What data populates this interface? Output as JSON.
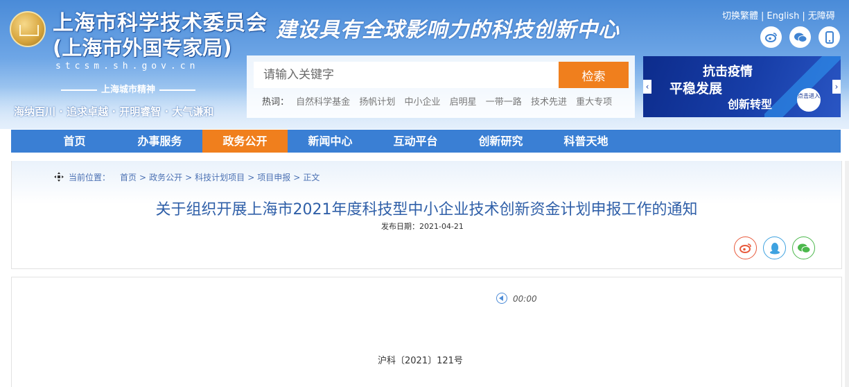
{
  "header": {
    "org_name_line1": "上海市科学技术委员会",
    "org_name_line2": "(上海市外国专家局)",
    "domain": "stcsm.sh.gov.cn",
    "spirit_title": "上海城市精神",
    "spirit_text": "海纳百川 · 追求卓越 · 开明睿智 · 大气谦和",
    "slogan": "建设具有全球影响力的科技创新中心",
    "top_links": [
      "切换繁體",
      "English",
      "无障碍"
    ],
    "top_link_separator": "|"
  },
  "search": {
    "placeholder": "请输入关键字",
    "button_label": "检索",
    "hot_label": "热词：",
    "hot_words": [
      "自然科学基金",
      "扬帆计划",
      "中小企业",
      "启明星",
      "一带一路",
      "技术先进",
      "重大专项"
    ]
  },
  "banner": {
    "line1": "抗击疫情",
    "line2": "平稳发展",
    "line3": "创新转型",
    "click_text": "点击进入"
  },
  "nav": {
    "items": [
      "首页",
      "办事服务",
      "政务公开",
      "新闻中心",
      "互动平台",
      "创新研究",
      "科普天地"
    ],
    "active_index": 2,
    "active_color": "#f07f1d",
    "bar_color": "#3a7fd4"
  },
  "breadcrumb": {
    "label": "当前位置：",
    "items": [
      "首页",
      "政务公开",
      "科技计划项目",
      "项目申报",
      "正文"
    ],
    "separator": ">"
  },
  "article": {
    "title": "关于组织开展上海市2021年度科技型中小企业技术创新资金计划申报工作的通知",
    "publish_label": "发布日期：",
    "publish_date": "2021-04-21",
    "audio_time": "00:00",
    "doc_number": "沪科〔2021〕121号"
  }
}
